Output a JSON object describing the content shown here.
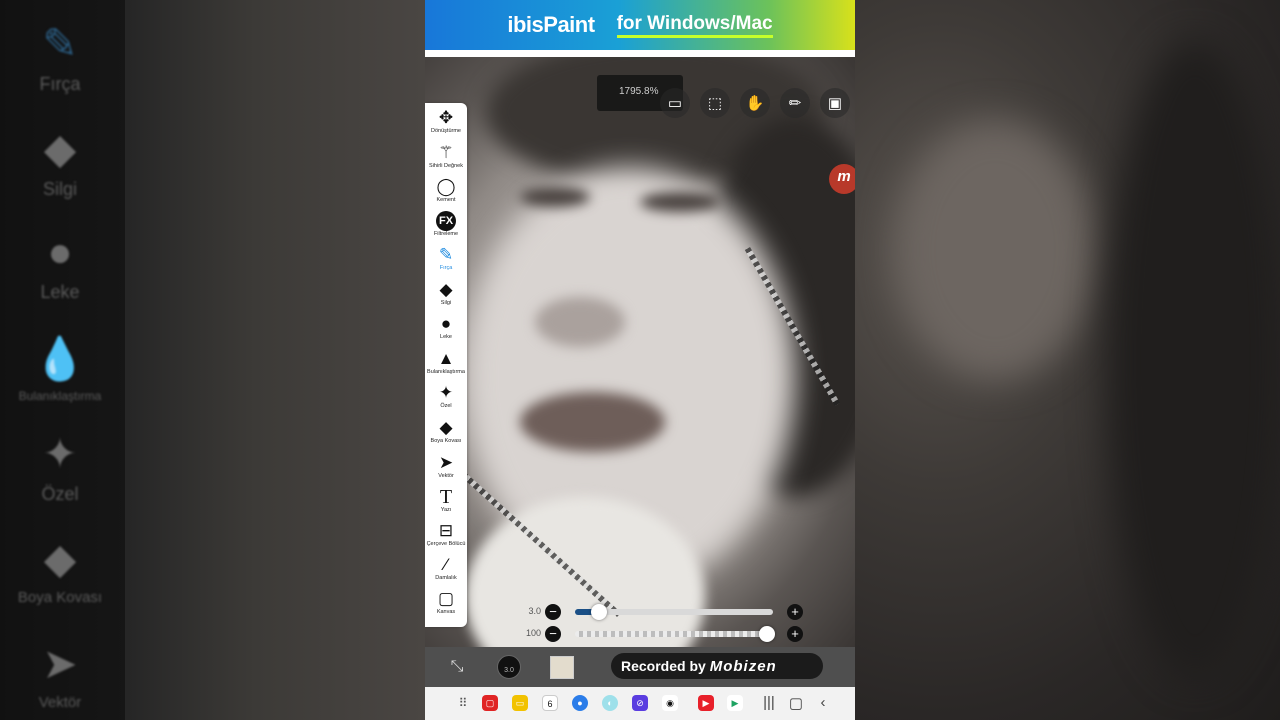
{
  "left_panel": {
    "items": [
      {
        "label": "Fırça",
        "icon": "brush-icon"
      },
      {
        "label": "Silgi",
        "icon": "eraser-icon"
      },
      {
        "label": "Leke",
        "icon": "smudge-icon"
      },
      {
        "label": "Bulanıklaştırma",
        "icon": "blur-drop-icon"
      },
      {
        "label": "Özel",
        "icon": "special-wand-icon"
      },
      {
        "label": "Boya Kovası",
        "icon": "paint-bucket-icon"
      },
      {
        "label": "Vektör",
        "icon": "vector-cursor-icon"
      }
    ]
  },
  "banner": {
    "logo": "ibisPaint",
    "tagline": "for Windows/Mac"
  },
  "canvas": {
    "zoom": "1795.8%"
  },
  "toolbar": {
    "tools": [
      {
        "label": "Dönüştürme",
        "icon": "move-icon"
      },
      {
        "label": "Sihirli Değnek",
        "icon": "magic-wand-icon"
      },
      {
        "label": "Kement",
        "icon": "lasso-icon"
      },
      {
        "label": "Filtreleme",
        "icon": "fx-icon"
      },
      {
        "label": "Fırça",
        "icon": "brush-icon",
        "active": true
      },
      {
        "label": "Silgi",
        "icon": "eraser-icon"
      },
      {
        "label": "Leke",
        "icon": "smudge-icon"
      },
      {
        "label": "Bulanıklaştırma",
        "icon": "blur-drop-icon"
      },
      {
        "label": "Özel",
        "icon": "special-wand-icon"
      },
      {
        "label": "Boya Kovası",
        "icon": "paint-bucket-icon"
      },
      {
        "label": "Vektör",
        "icon": "vector-cursor-icon"
      },
      {
        "label": "Yazı",
        "icon": "text-icon"
      },
      {
        "label": "Çerçeve Bölücü",
        "icon": "frame-divider-icon"
      },
      {
        "label": "Damlalık",
        "icon": "eyedropper-icon"
      },
      {
        "label": "Kanvas",
        "icon": "canvas-icon"
      }
    ]
  },
  "sliders": {
    "size": {
      "value": "3.0",
      "level": 0.09
    },
    "opacity": {
      "value": "100",
      "level": 1.0
    }
  },
  "bottom_bar": {
    "brush_size": "3.0",
    "color": "#e3dccd",
    "recorded_prefix": "Recorded by",
    "recorded_brand": "Mobizen"
  },
  "recording_badge": "m",
  "navbar": {
    "apps": [
      "apps-grid-icon",
      "app-red-icon",
      "app-yellow-icon",
      "calendar-icon",
      "messages-icon",
      "app-cyan-icon",
      "app-purple-icon",
      "camera-icon",
      "youtube-icon",
      "play-store-icon"
    ],
    "calendar_day": "6"
  }
}
